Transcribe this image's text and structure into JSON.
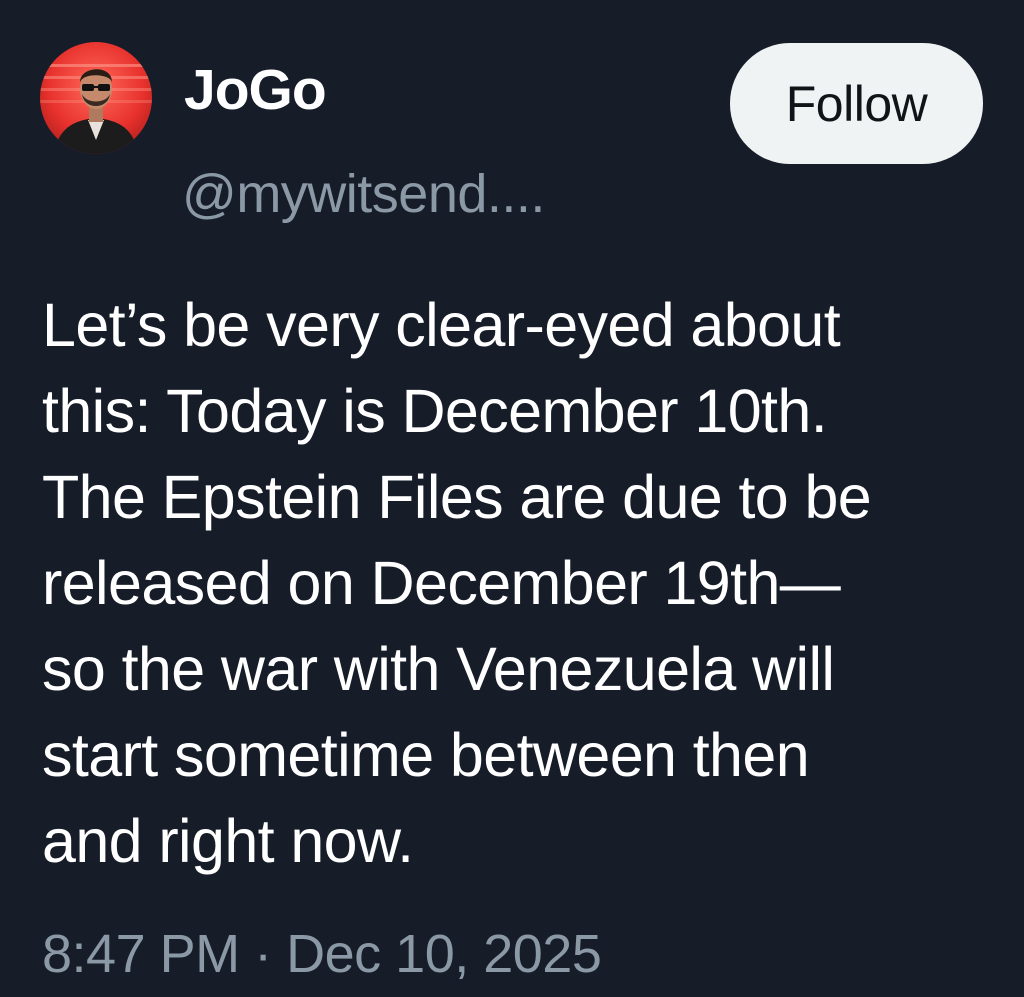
{
  "author": {
    "display_name": "JoGo",
    "handle": "@mywitsend...."
  },
  "follow_button": {
    "label": "Follow"
  },
  "tweet": {
    "lines": [
      "Let’s be very clear-eyed about",
      "this: Today is December 10th.",
      "The Epstein Files are due to be",
      "released on December 19th—",
      "so the war with Venezuela will",
      "start sometime between then",
      "and right now."
    ],
    "time": "8:47 PM",
    "separator": "·",
    "date": "Dec 10, 2025"
  },
  "colors": {
    "background": "#161d29",
    "text_primary": "#ffffff",
    "text_secondary": "#8b98a5",
    "follow_bg": "#eff3f4",
    "follow_text": "#0f1419",
    "avatar_accent": "#e8322d"
  },
  "icons": {
    "avatar": "profile-photo-man-sunglasses-red-background"
  }
}
